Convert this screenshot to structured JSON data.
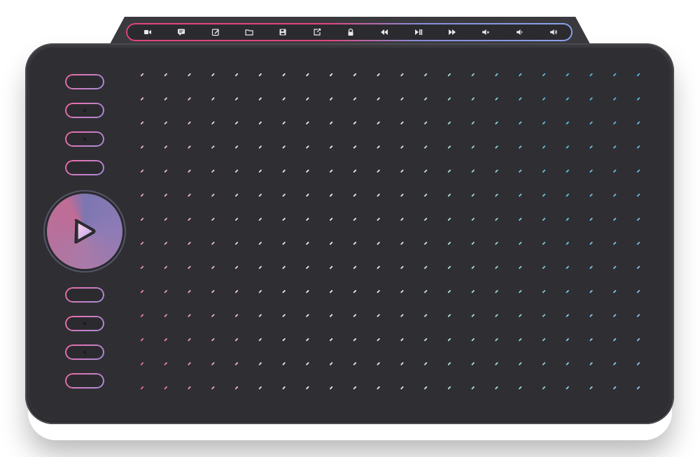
{
  "device": {
    "type": "drawing-tablet"
  },
  "shortcut_bar": {
    "keys": [
      {
        "icon": "video-camera-icon",
        "name": "shortcut-camera"
      },
      {
        "icon": "chat-message-icon",
        "name": "shortcut-message"
      },
      {
        "icon": "edit-square-icon",
        "name": "shortcut-edit"
      },
      {
        "icon": "folder-icon",
        "name": "shortcut-folder"
      },
      {
        "icon": "save-floppy-icon",
        "name": "shortcut-save"
      },
      {
        "icon": "export-icon",
        "name": "shortcut-export"
      },
      {
        "icon": "lock-icon",
        "name": "shortcut-lock"
      },
      {
        "icon": "rewind-icon",
        "name": "shortcut-rewind"
      },
      {
        "icon": "play-pause-icon",
        "name": "shortcut-play-pause"
      },
      {
        "icon": "fast-forward-icon",
        "name": "shortcut-fast-forward"
      },
      {
        "icon": "volume-mute-icon",
        "name": "shortcut-mute"
      },
      {
        "icon": "volume-down-icon",
        "name": "shortcut-volume-down"
      },
      {
        "icon": "volume-up-icon",
        "name": "shortcut-volume-up"
      }
    ],
    "gradient": [
      "#e2457f",
      "#8aa4e8"
    ]
  },
  "express_keys_top": {
    "count": 4
  },
  "express_keys_bottom": {
    "count": 4
  },
  "dial": {
    "center_icon": "play-icon"
  },
  "active_area": {
    "columns": 22,
    "rows": 14,
    "colors": {
      "pink": "#f06aa3",
      "white": "#f4eef4",
      "teal": "#4fd8c0",
      "blue": "#5ab8f0"
    }
  }
}
